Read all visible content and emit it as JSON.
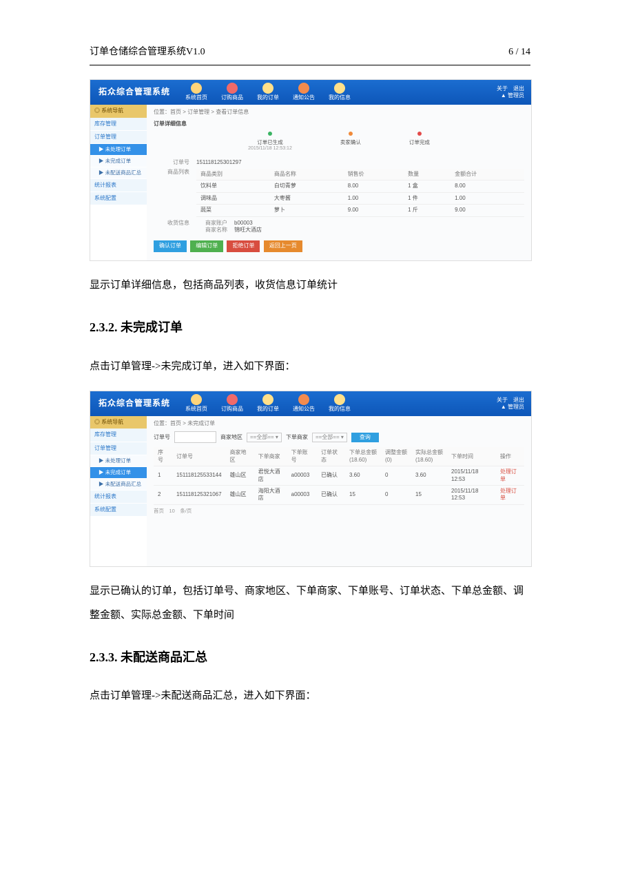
{
  "header": {
    "title": "订单仓储综合管理系统V1.0",
    "page": "6 / 14"
  },
  "shot1": {
    "logo": "拓众综合管理系统",
    "nav": [
      "系统首页",
      "订购商品",
      "我的订单",
      "通知公告",
      "我的信息"
    ],
    "user_top": "关于　退出",
    "user_bottom": "▲ 管理员",
    "sb_head": "◎ 系统导航",
    "sb": [
      "库存管理",
      "订单管理"
    ],
    "sb_sub": [
      "▶ 未处理订单",
      "▶ 未完成订单",
      "▶ 未配送商品汇总"
    ],
    "sb_tail": [
      "统计报表",
      "系统配置"
    ],
    "crumb": "位置：首页 > 订单管理 > 查看订单信息",
    "panel": "订单详细信息",
    "steps": [
      {
        "t": "订单已生成",
        "s": "2015/11/18 12:53:12"
      },
      {
        "t": "卖家确认",
        "s": ""
      },
      {
        "t": "订单完成",
        "s": ""
      }
    ],
    "orderno_k": "订单号",
    "orderno_v": "151118125301297",
    "goods_k": "商品列表",
    "cols": [
      "商品类别",
      "商品名称",
      "销售价",
      "数量",
      "金额合计"
    ],
    "rows": [
      [
        "饮料单",
        "白切青萝",
        "8.00",
        "1 盒",
        "8.00"
      ],
      [
        "调味品",
        "大枣酱",
        "1.00",
        "1 件",
        "1.00"
      ],
      [
        "蔬菜",
        "萝卜",
        "9.00",
        "1 斤",
        "9.00"
      ]
    ],
    "recv_k": "收货信息",
    "recv1_k": "商家账户",
    "recv1_v": "b00003",
    "recv2_k": "商家名称",
    "recv2_v": "锦旺大酒店",
    "btns": [
      "确认订单",
      "编辑订单",
      "拒绝订单",
      "返回上一页"
    ]
  },
  "para1": "显示订单详细信息，包括商品列表，收货信息订单统计",
  "h232": "2.3.2. 未完成订单",
  "para2": "点击订单管理->未完成订单，进入如下界面：",
  "shot2": {
    "logo": "拓众综合管理系统",
    "nav": [
      "系统首页",
      "订购商品",
      "我的订单",
      "通知公告",
      "我的信息"
    ],
    "user_top": "关于　退出",
    "user_bottom": "▲ 管理员",
    "sb_head": "◎ 系统导航",
    "sb": [
      "库存管理",
      "订单管理"
    ],
    "sb_sub": [
      "▶ 未处理订单",
      "▶ 未完成订单",
      "▶ 未配送商品汇总"
    ],
    "sb_tail": [
      "统计报表",
      "系统配置"
    ],
    "crumb": "位置：首页 > 未完成订单",
    "f_orderno": "订单号",
    "f_area": "商家地区",
    "f_area_v": "==全部==",
    "f_shop": "下单商家",
    "f_shop_v": "==全部==",
    "f_query": "查询",
    "cols": [
      "序号",
      "订单号",
      "商家地区",
      "下单商家",
      "下单账号",
      "订单状态",
      "下单总金额\n(18.60)",
      "调整金额\n(0)",
      "实际总金额\n(18.60)",
      "下单时间",
      "操作"
    ],
    "rows": [
      [
        "1",
        "151118125533144",
        "雄山区",
        "君悦大酒店",
        "a00003",
        "已确认",
        "3.60",
        "0",
        "3.60",
        "2015/11/18 12:53",
        "处理订单"
      ],
      [
        "2",
        "151118125321067",
        "雄山区",
        "海阳大酒店",
        "a00003",
        "已确认",
        "15",
        "0",
        "15",
        "2015/11/18 12:53",
        "处理订单"
      ]
    ],
    "pager": "首页　10　条/页"
  },
  "para3": "显示已确认的订单，包括订单号、商家地区、下单商家、下单账号、订单状态、下单总金额、调整金额、实际总金额、下单时间",
  "h233": "2.3.3. 未配送商品汇总",
  "para4": "点击订单管理->未配送商品汇总，进入如下界面："
}
